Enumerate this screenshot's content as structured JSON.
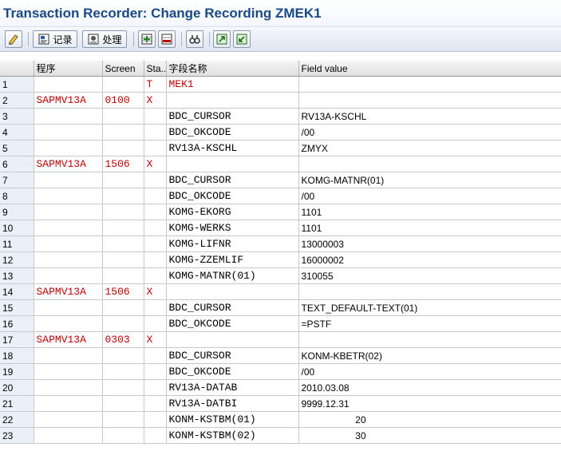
{
  "window": {
    "title": "Transaction Recorder: Change Recording ZMEK1"
  },
  "toolbar": {
    "buttons": [
      {
        "icon": "edit-icon",
        "label": ""
      },
      {
        "icon": "record-icon",
        "label": "记录"
      },
      {
        "icon": "process-icon",
        "label": "处理"
      },
      {
        "icon": "insert-row-icon",
        "label": ""
      },
      {
        "icon": "delete-row-icon",
        "label": ""
      },
      {
        "icon": "find-icon",
        "label": ""
      },
      {
        "icon": "export-icon",
        "label": ""
      },
      {
        "icon": "import-icon",
        "label": ""
      }
    ]
  },
  "table": {
    "columns": [
      "",
      "程序",
      "Screen",
      "Sta...",
      "字段名称",
      "Field value"
    ],
    "rows": [
      {
        "n": "1",
        "program": "",
        "screen": "",
        "start": "T",
        "field": "MEK1",
        "value": "",
        "field_red": true
      },
      {
        "n": "2",
        "program": "SAPMV13A",
        "screen": "0100",
        "start": "X",
        "field": "",
        "value": ""
      },
      {
        "n": "3",
        "program": "",
        "screen": "",
        "start": "",
        "field": "BDC_CURSOR",
        "value": "RV13A-KSCHL"
      },
      {
        "n": "4",
        "program": "",
        "screen": "",
        "start": "",
        "field": "BDC_OKCODE",
        "value": "/00"
      },
      {
        "n": "5",
        "program": "",
        "screen": "",
        "start": "",
        "field": "RV13A-KSCHL",
        "value": "ZMYX"
      },
      {
        "n": "6",
        "program": "SAPMV13A",
        "screen": "1506",
        "start": "X",
        "field": "",
        "value": ""
      },
      {
        "n": "7",
        "program": "",
        "screen": "",
        "start": "",
        "field": "BDC_CURSOR",
        "value": "KOMG-MATNR(01)"
      },
      {
        "n": "8",
        "program": "",
        "screen": "",
        "start": "",
        "field": "BDC_OKCODE",
        "value": "/00"
      },
      {
        "n": "9",
        "program": "",
        "screen": "",
        "start": "",
        "field": "KOMG-EKORG",
        "value": "1101"
      },
      {
        "n": "10",
        "program": "",
        "screen": "",
        "start": "",
        "field": "KOMG-WERKS",
        "value": "1101"
      },
      {
        "n": "11",
        "program": "",
        "screen": "",
        "start": "",
        "field": "KOMG-LIFNR",
        "value": "13000003"
      },
      {
        "n": "12",
        "program": "",
        "screen": "",
        "start": "",
        "field": "KOMG-ZZEMLIF",
        "value": "16000002"
      },
      {
        "n": "13",
        "program": "",
        "screen": "",
        "start": "",
        "field": "KOMG-MATNR(01)",
        "value": "310055"
      },
      {
        "n": "14",
        "program": "SAPMV13A",
        "screen": "1506",
        "start": "X",
        "field": "",
        "value": ""
      },
      {
        "n": "15",
        "program": "",
        "screen": "",
        "start": "",
        "field": "BDC_CURSOR",
        "value": "TEXT_DEFAULT-TEXT(01)"
      },
      {
        "n": "16",
        "program": "",
        "screen": "",
        "start": "",
        "field": "BDC_OKCODE",
        "value": "=PSTF"
      },
      {
        "n": "17",
        "program": "SAPMV13A",
        "screen": "0303",
        "start": "X",
        "field": "",
        "value": ""
      },
      {
        "n": "18",
        "program": "",
        "screen": "",
        "start": "",
        "field": "BDC_CURSOR",
        "value": "KONM-KBETR(02)"
      },
      {
        "n": "19",
        "program": "",
        "screen": "",
        "start": "",
        "field": "BDC_OKCODE",
        "value": "/00"
      },
      {
        "n": "20",
        "program": "",
        "screen": "",
        "start": "",
        "field": "RV13A-DATAB",
        "value": "2010.03.08"
      },
      {
        "n": "21",
        "program": "",
        "screen": "",
        "start": "",
        "field": "RV13A-DATBI",
        "value": "9999.12.31"
      },
      {
        "n": "22",
        "program": "",
        "screen": "",
        "start": "",
        "field": "KONM-KSTBM(01)",
        "value": "20",
        "right": true
      },
      {
        "n": "23",
        "program": "",
        "screen": "",
        "start": "",
        "field": "KONM-KSTBM(02)",
        "value": "30",
        "right": true
      }
    ]
  },
  "colors": {
    "title": "#1a4a86",
    "program_text": "#c00000"
  }
}
